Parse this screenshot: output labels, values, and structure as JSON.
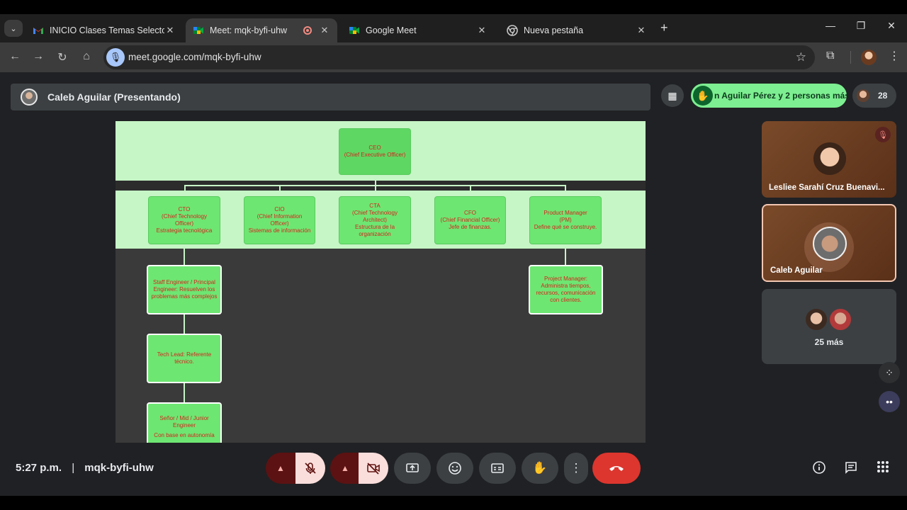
{
  "browser": {
    "tabs": [
      {
        "title": "INICIO Clases Temas Selectos II",
        "favicon": "gmail-icon",
        "active": false
      },
      {
        "title": "Meet: mqk-byfi-uhw",
        "favicon": "meet-icon",
        "active": true,
        "recording": true
      },
      {
        "title": "Google Meet",
        "favicon": "meet-icon",
        "active": false
      },
      {
        "title": "Nueva pestaña",
        "favicon": "chrome-icon",
        "active": false
      }
    ],
    "url": "meet.google.com/mqk-byfi-uhw",
    "window_controls": {
      "minimize": "—",
      "restore": "❐",
      "close": "✕"
    }
  },
  "meet": {
    "presenter_label": "Caleb Aguilar (Presentando)",
    "raised_hands_text": "n Aguilar Pérez y 2 personas más",
    "participants_count": "28",
    "tiles": [
      {
        "name": "Lesliee Sarahí Cruz Buenavi...",
        "muted": true
      },
      {
        "name": "Caleb Aguilar",
        "active_speaker": true
      },
      {
        "name": "25 más"
      }
    ],
    "time": "5:27 p.m.",
    "separator": "|",
    "meeting_code": "mqk-byfi-uhw"
  },
  "org_chart": {
    "ceo": {
      "title": "CEO",
      "subtitle": "(Chief Executive Officer)"
    },
    "level2": [
      {
        "title": "CTO",
        "subtitle": "(Chief Technology Officer)",
        "desc": "Estrategia tecnológica"
      },
      {
        "title": "CIO",
        "subtitle": "(Chief Information Officer)",
        "desc": "Sistemas de información"
      },
      {
        "title": "CTA",
        "subtitle": "(Chief Technology Architect)",
        "desc": "Estructura de la organización"
      },
      {
        "title": "CFO",
        "subtitle": "(Chief Financial Officer)",
        "desc": "Jefe de finanzas."
      },
      {
        "title": "Product Manager",
        "subtitle": "(PM)",
        "desc": "Define qué se construye."
      }
    ],
    "staff_engineer": "Staff Engineer / Principal Engineer: Resuelven los problemas más complejos",
    "tech_lead": "Tech Lead: Referente técnico.",
    "engineers": {
      "title": "Señor / Mid / Junior Engineer",
      "desc": "Con base en autonomía"
    },
    "project_manager": "Project Manager: Administra tiempos, recursos, comunicación con clientes."
  },
  "colors": {
    "band": "#c6f5c6",
    "box": "#6ee672",
    "box_text": "#d3261e",
    "hangup": "#dc362e",
    "raise_pill": "#7dee91"
  }
}
